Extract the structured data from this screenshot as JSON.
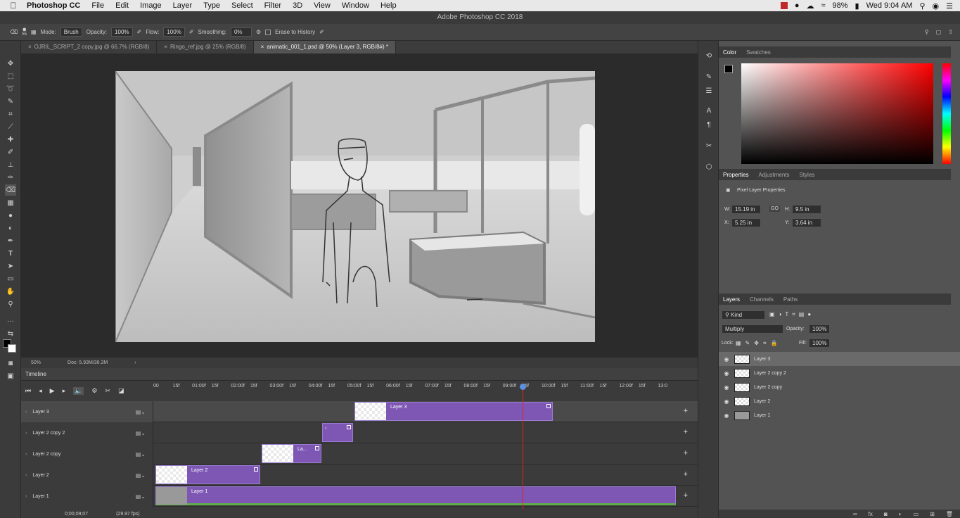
{
  "menubar": {
    "app": "Photoshop CC",
    "items": [
      "File",
      "Edit",
      "Image",
      "Layer",
      "Type",
      "Select",
      "Filter",
      "3D",
      "View",
      "Window",
      "Help"
    ],
    "battery": "98%",
    "clock": "Wed 9:04 AM"
  },
  "window": {
    "title": "Adobe Photoshop CC 2018"
  },
  "options": {
    "brush_size": "55",
    "mode_label": "Mode:",
    "mode_value": "Brush",
    "opacity_label": "Opacity:",
    "opacity_value": "100%",
    "flow_label": "Flow:",
    "flow_value": "100%",
    "smoothing_label": "Smoothing:",
    "smoothing_value": "0%",
    "erase_history": "Erase to History"
  },
  "tabs": [
    {
      "label": "OJRIL_SCRIPT_2 copy.jpg @ 66.7% (RGB/8)"
    },
    {
      "label": "Ringo_ref.jpg @ 25% (RGB/8)"
    },
    {
      "label": "animatic_001_1.psd @ 50% (Layer 3, RGB/8#) *"
    }
  ],
  "status": {
    "zoom": "50%",
    "doc": "Doc: 5.93M/36.3M"
  },
  "timeline": {
    "title": "Timeline",
    "ruler": [
      "00",
      "15f",
      "01:00f",
      "15f",
      "02:00f",
      "15f",
      "03:00f",
      "15f",
      "04:00f",
      "15f",
      "05:00f",
      "15f",
      "06:00f",
      "15f",
      "07:00f",
      "15f",
      "08:00f",
      "15f",
      "09:00f",
      "15f",
      "10:00f",
      "15f",
      "11:00f",
      "15f",
      "12:00f",
      "15f",
      "13:0"
    ],
    "tracks": [
      {
        "name": "Layer 3",
        "clip": "Layer 3"
      },
      {
        "name": "Layer 2 copy 2",
        "clip": ""
      },
      {
        "name": "Layer 2 copy",
        "clip": "La..."
      },
      {
        "name": "Layer 2",
        "clip": "Layer 2"
      },
      {
        "name": "Layer 1",
        "clip": "Layer 1"
      }
    ],
    "timecode": "0;00;09;07",
    "fps": "(29.97 fps)"
  },
  "color_panel": {
    "tabs": [
      "Color",
      "Swatches"
    ]
  },
  "properties": {
    "tabs": [
      "Properties",
      "Adjustments",
      "Styles"
    ],
    "heading": "Pixel Layer Properties",
    "w_label": "W:",
    "w": "15.19 in",
    "h_label": "H:",
    "h": "9.5 in",
    "x_label": "X:",
    "x": "5.25 in",
    "y_label": "Y:",
    "y": "3.64 in",
    "link": "GO"
  },
  "layers_panel": {
    "tabs": [
      "Layers",
      "Channels",
      "Paths"
    ],
    "kind": "Kind",
    "blend": "Multiply",
    "opacity_label": "Opacity:",
    "opacity": "100%",
    "lock_label": "Lock:",
    "fill_label": "Fill:",
    "fill": "100%",
    "layers": [
      "Layer 3",
      "Layer 2 copy 2",
      "Layer 2 copy",
      "Layer 2",
      "Layer 1"
    ]
  }
}
